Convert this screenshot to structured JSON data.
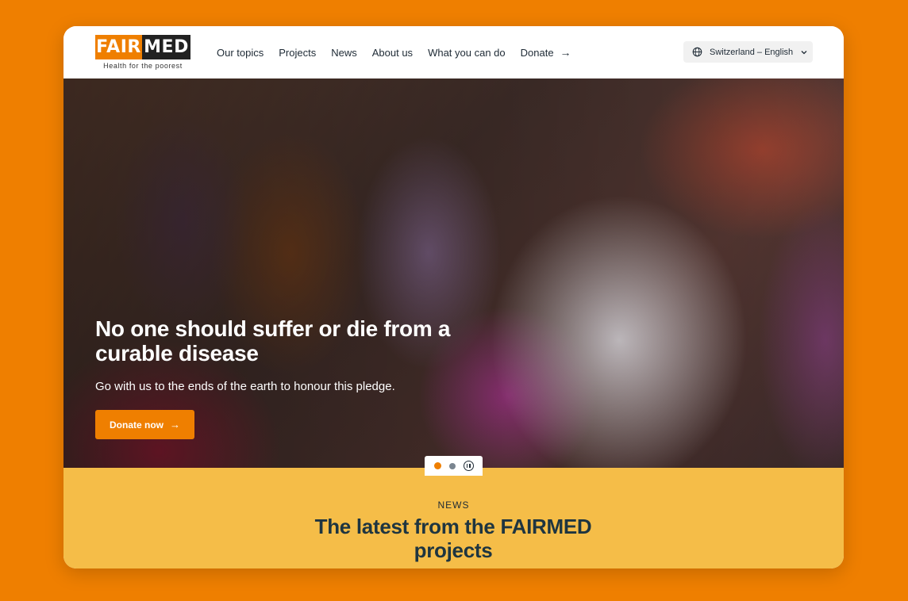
{
  "logo": {
    "fair": "FAIR",
    "med": "MED",
    "tagline": "Health for the poorest",
    "colors": {
      "fair_bg": "#ef7f00",
      "med_bg": "#222222"
    }
  },
  "nav": {
    "items": [
      {
        "label": "Our topics"
      },
      {
        "label": "Projects"
      },
      {
        "label": "News"
      },
      {
        "label": "About us"
      },
      {
        "label": "What you can do"
      },
      {
        "label": "Donate",
        "icon": "arrow-right-icon"
      }
    ]
  },
  "language": {
    "label": "Switzerland – English",
    "icon": "globe-icon",
    "dropdown_icon": "chevron-down-icon"
  },
  "hero": {
    "title": "No one should suffer or die from a curable disease",
    "subtitle": "Go with us to the ends of the earth to honour this pledge.",
    "cta_label": "Donate now",
    "cta_icon": "arrow-right-icon",
    "slider": {
      "slide_count": 2,
      "active_slide": 1,
      "pause_icon": "pause-icon"
    }
  },
  "news": {
    "label": "NEWS",
    "title": "The latest from the FAIRMED projects"
  },
  "colors": {
    "page_bg": "#ef7f00",
    "accent": "#ef7f00",
    "news_bg": "#f5bd48",
    "text_dark": "#1e2a35"
  }
}
